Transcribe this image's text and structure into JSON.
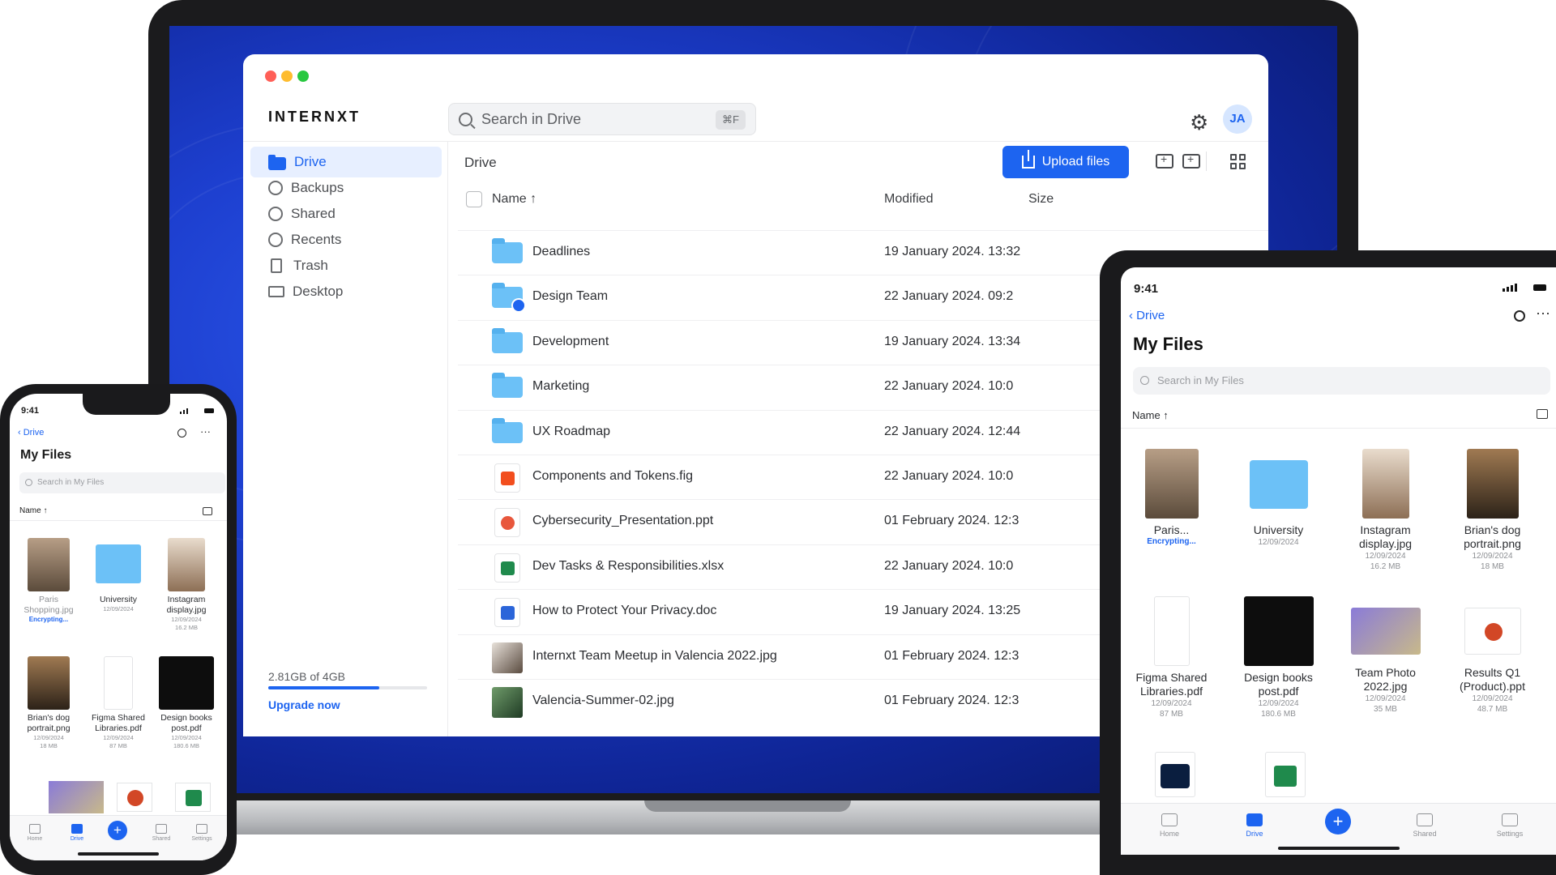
{
  "laptop": {
    "logo": "INTERNXT",
    "search_placeholder": "Search in Drive",
    "search_shortcut": "⌘F",
    "avatar_initials": "JA",
    "sidebar": [
      {
        "label": "Drive",
        "icon": "folder-icon",
        "active": true
      },
      {
        "label": "Backups",
        "icon": "history-icon"
      },
      {
        "label": "Shared",
        "icon": "users-icon"
      },
      {
        "label": "Recents",
        "icon": "clock-icon"
      },
      {
        "label": "Trash",
        "icon": "trash-icon"
      },
      {
        "label": "Desktop",
        "icon": "monitor-icon"
      }
    ],
    "storage": {
      "text": "2.81GB of 4GB",
      "used_fraction": 0.7
    },
    "upgrade_label": "Upgrade now",
    "breadcrumb": "Drive",
    "upload_label": "Upload files",
    "columns": {
      "name": "Name ↑",
      "modified": "Modified",
      "size": "Size"
    },
    "rows": [
      {
        "name": "Deadlines",
        "modified": "19 January 2024. 13:32",
        "type": "folder"
      },
      {
        "name": "Design Team",
        "modified": "22 January 2024. 09:2",
        "type": "shared-folder"
      },
      {
        "name": "Development",
        "modified": "19 January 2024. 13:34",
        "type": "folder"
      },
      {
        "name": "Marketing",
        "modified": "22 January 2024. 10:0",
        "type": "folder"
      },
      {
        "name": "UX Roadmap",
        "modified": "22 January 2024. 12:44",
        "type": "folder"
      },
      {
        "name": "Components and Tokens.fig",
        "modified": "22 January 2024. 10:0",
        "type": "figma"
      },
      {
        "name": "Cybersecurity_Presentation.ppt",
        "modified": "01 February 2024. 12:3",
        "type": "ppt"
      },
      {
        "name": "Dev Tasks & Responsibilities.xlsx",
        "modified": "22 January 2024. 10:0",
        "type": "xls"
      },
      {
        "name": "How to Protect Your Privacy.doc",
        "modified": "19 January 2024. 13:25",
        "type": "doc"
      },
      {
        "name": "Internxt Team Meetup in Valencia 2022.jpg",
        "modified": "01 February 2024. 12:3",
        "type": "photo"
      },
      {
        "name": "Valencia-Summer-02.jpg",
        "modified": "01 February 2024. 12:3",
        "type": "photo"
      }
    ]
  },
  "tablet": {
    "time": "9:41",
    "back_label": "Drive",
    "title": "My Files",
    "search_placeholder": "Search in My Files",
    "sort_label": "Name ↑",
    "items": [
      {
        "name": "Paris...",
        "meta": "",
        "status": "Encrypting..."
      },
      {
        "name": "University",
        "meta": "12/09/2024",
        "status": ""
      },
      {
        "name": "Instagram display.jpg",
        "meta": "12/09/2024",
        "size": "16.2 MB"
      },
      {
        "name": "Brian's dog portrait.png",
        "meta": "12/09/2024",
        "size": "18 MB"
      },
      {
        "name": "Figma Shared Libraries.pdf",
        "meta": "12/09/2024",
        "size": "87 MB"
      },
      {
        "name": "Design books post.pdf",
        "meta": "12/09/2024",
        "size": "180.6 MB"
      },
      {
        "name": "Team Photo 2022.jpg",
        "meta": "12/09/2024",
        "size": "35 MB"
      },
      {
        "name": "Results Q1 (Product).ppt",
        "meta": "12/09/2024",
        "size": "48.7 MB"
      }
    ],
    "tabs": [
      "Home",
      "Drive",
      "Shared",
      "Settings"
    ]
  },
  "phone": {
    "time": "9:41",
    "back_label": "Drive",
    "title": "My Files",
    "search_placeholder": "Search in My Files",
    "sort_label": "Name ↑",
    "items": [
      {
        "name": "Paris Shopping.jpg",
        "meta": "",
        "status": "Encrypting..."
      },
      {
        "name": "University",
        "meta": "12/09/2024",
        "size": ""
      },
      {
        "name": "Instagram display.jpg",
        "meta": "12/09/2024",
        "size": "16.2 MB"
      },
      {
        "name": "Brian's dog portrait.png",
        "meta": "12/09/2024",
        "size": "18 MB"
      },
      {
        "name": "Figma Shared Libraries.pdf",
        "meta": "12/09/2024",
        "size": "87 MB"
      },
      {
        "name": "Design books post.pdf",
        "meta": "12/09/2024",
        "size": "180.6 MB"
      }
    ],
    "tabs": [
      "Home",
      "Drive",
      "Shared",
      "Settings"
    ]
  },
  "colors": {
    "accent": "#1d64f0",
    "folder": "#6cc1f7",
    "wallpaper": "#1d3fcf"
  }
}
